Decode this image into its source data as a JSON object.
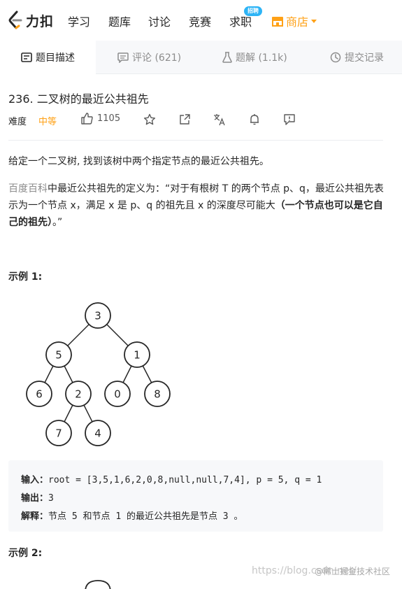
{
  "nav": {
    "logo_text": "力扣",
    "items": [
      "学习",
      "题库",
      "讨论",
      "竞赛",
      "求职"
    ],
    "badge": "招聘",
    "shop": "商店",
    "accent": "#ffa116"
  },
  "tabs": [
    {
      "label": "题目描述",
      "icon": "description-icon"
    },
    {
      "label": "评论 (621)",
      "icon": "comment-icon"
    },
    {
      "label": "题解 (1.1k)",
      "icon": "flask-icon"
    },
    {
      "label": "提交记录",
      "icon": "clock-icon"
    }
  ],
  "problem": {
    "title": "236. 二叉树的最近公共祖先",
    "difficulty_label": "难度",
    "difficulty": "中等",
    "likes": "1105",
    "actions": [
      "star-icon",
      "share-icon",
      "translate-icon",
      "bell-icon",
      "feedback-icon"
    ]
  },
  "description": {
    "p1": "给定一个二叉树, 找到该树中两个指定节点的最近公共祖先。",
    "p2_link": "百度百科",
    "p2_text": "中最近公共祖先的定义为：“对于有根树 T 的两个节点 p、q，最近公共祖先表示为一个节点 x，满足 x 是 p、q 的祖先且 x 的深度尽可能大",
    "p2_bold": "（一个节点也可以是它自己的祖先）",
    "p2_end": "。”"
  },
  "example1": {
    "heading": "示例 1:",
    "tree_nodes": [
      "3",
      "5",
      "1",
      "6",
      "2",
      "0",
      "8",
      "7",
      "4"
    ],
    "input_label": "输入：",
    "input_value": "root = [3,5,1,6,2,0,8,null,null,7,4], p = 5, q = 1",
    "output_label": "输出：",
    "output_value": "3",
    "explain_label": "解释：",
    "explain_value": "节点 5 和节点 1 的最近公共祖先是节点 3 。"
  },
  "example2": {
    "heading": "示例 2:"
  },
  "watermark": {
    "url": "https://blog.csdn.net/",
    "site": "@稀土掘金技术社区"
  }
}
